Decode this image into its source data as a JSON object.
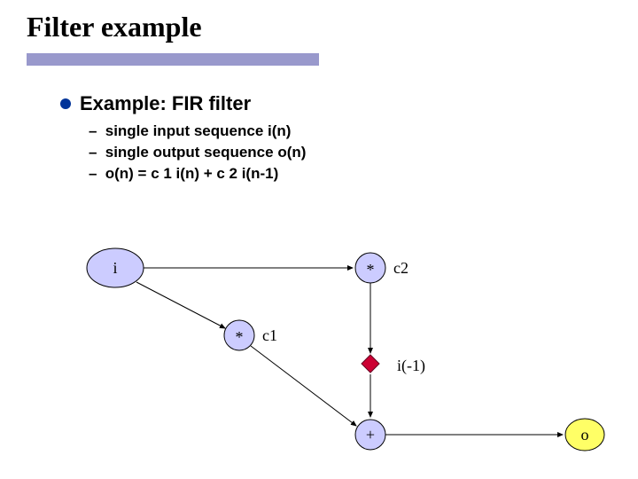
{
  "title": "Filter example",
  "heading": "Example: FIR filter",
  "bullets": [
    "single input sequence i(n)",
    "single output sequence o(n)",
    "o(n) = c 1 i(n) + c 2 i(n-1)"
  ],
  "nodes": {
    "i": "i",
    "mul1": "*",
    "mul2": "*",
    "plus": "+",
    "o": "o"
  },
  "labels": {
    "c1": "c1",
    "c2": "c2",
    "delay": "i(-1)"
  },
  "colors": {
    "accent_bar": "#9999cc",
    "bullet_dot": "#003399",
    "node_fill": "#ccccff",
    "node_stroke": "#000000",
    "arrow": "#000000",
    "diamond_fill": "#cc0033",
    "o_fill": "#ffff66"
  }
}
